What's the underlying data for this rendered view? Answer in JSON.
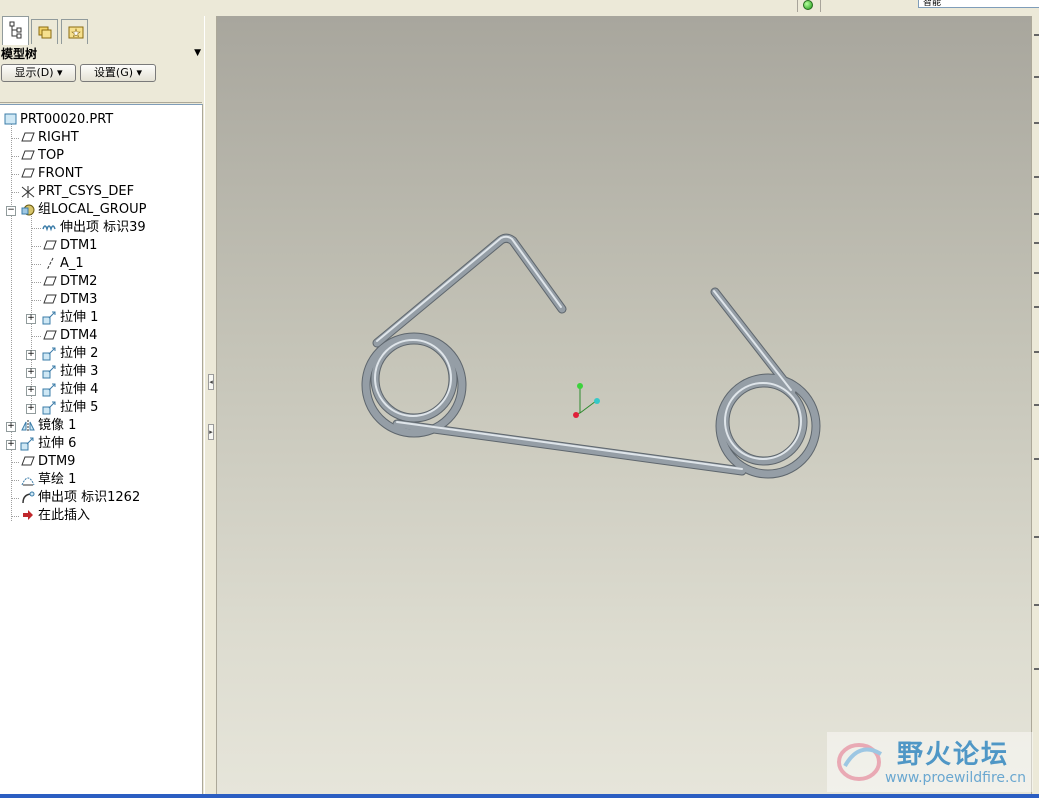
{
  "top_combo": "智能",
  "panel": {
    "title": "模型树",
    "show_button": "显示(D) ▾",
    "settings_button": "设置(G) ▾"
  },
  "tree": {
    "root": "PRT00020.PRT",
    "items": [
      {
        "label": "RIGHT",
        "icon": "datum-plane-icon"
      },
      {
        "label": "TOP",
        "icon": "datum-plane-icon"
      },
      {
        "label": "FRONT",
        "icon": "datum-plane-icon"
      },
      {
        "label": "PRT_CSYS_DEF",
        "icon": "coordinate-system-icon"
      },
      {
        "label": "组LOCAL_GROUP",
        "icon": "group-icon"
      },
      {
        "label": "伸出项 标识39",
        "icon": "protrusion-icon"
      },
      {
        "label": "DTM1",
        "icon": "datum-plane-icon"
      },
      {
        "label": "A_1",
        "icon": "datum-axis-icon"
      },
      {
        "label": "DTM2",
        "icon": "datum-plane-icon"
      },
      {
        "label": "DTM3",
        "icon": "datum-plane-icon"
      },
      {
        "label": "拉伸 1",
        "icon": "extrude-icon"
      },
      {
        "label": "DTM4",
        "icon": "datum-plane-icon"
      },
      {
        "label": "拉伸 2",
        "icon": "extrude-icon"
      },
      {
        "label": "拉伸 3",
        "icon": "extrude-icon"
      },
      {
        "label": "拉伸 4",
        "icon": "extrude-icon"
      },
      {
        "label": "拉伸 5",
        "icon": "extrude-icon"
      },
      {
        "label": "镜像 1",
        "icon": "mirror-icon"
      },
      {
        "label": "拉伸 6",
        "icon": "extrude-icon"
      },
      {
        "label": "DTM9",
        "icon": "datum-plane-icon"
      },
      {
        "label": "草绘 1",
        "icon": "sketch-icon"
      },
      {
        "label": "伸出项 标识1262",
        "icon": "sweep-icon"
      },
      {
        "label": "在此插入",
        "icon": "insert-here-arrow-icon"
      }
    ]
  },
  "watermark": {
    "title": "野火论坛",
    "url": "www.proewildfire.cn"
  },
  "colors": {
    "spring": "#8e98a0",
    "insert_arrow": "#c0282c"
  }
}
